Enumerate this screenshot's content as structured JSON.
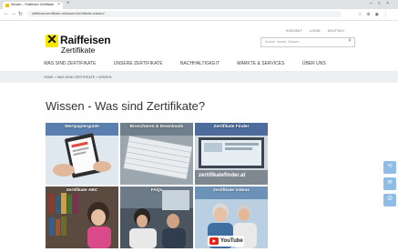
{
  "browser": {
    "tab_title": "Wissen – Raiffeisen Zertifikate",
    "url": "raiffeisenzertifikate.at/wissen/zertifikate-wissen/"
  },
  "header": {
    "logo_line1": "Raiffeisen",
    "logo_line2": "Zertifikate",
    "top_links": [
      "KONTAKT",
      "LOGIN",
      "DEUTSCH"
    ],
    "search_placeholder": "Suche, Name, Wissen"
  },
  "nav": {
    "items": [
      "WAS SIND ZERTIFIKATE",
      "UNSERE ZERTIFIKATE",
      "NACHHALTIGKEIT",
      "MÄRKTE & SERVICES",
      "ÜBER UNS"
    ]
  },
  "breadcrumb": "HOME  >  WAS SIND ZERTIFIKATE  >  WISSEN",
  "page": {
    "title": "Wissen - Was sind Zertifikate?"
  },
  "tiles": [
    {
      "label": "Wertpapierguide",
      "color": "#5a7fae"
    },
    {
      "label": "Broschüren & Downloads",
      "color": "#6f7f8c"
    },
    {
      "label": "Zertifikate Finder",
      "color": "#4d6c9c"
    },
    {
      "label": "Zertifikate ABC",
      "color": "#7a6a5e"
    },
    {
      "label": "FAQs",
      "color": "#5f6f80"
    },
    {
      "label": "Zertifikate Videos",
      "color": "#6c92b8"
    }
  ],
  "tile_extra": {
    "finder_caption": "zertifikatefinder.at",
    "video_logo": "YouTube"
  },
  "side_actions": [
    "share-icon",
    "mail-icon",
    "print-icon"
  ]
}
